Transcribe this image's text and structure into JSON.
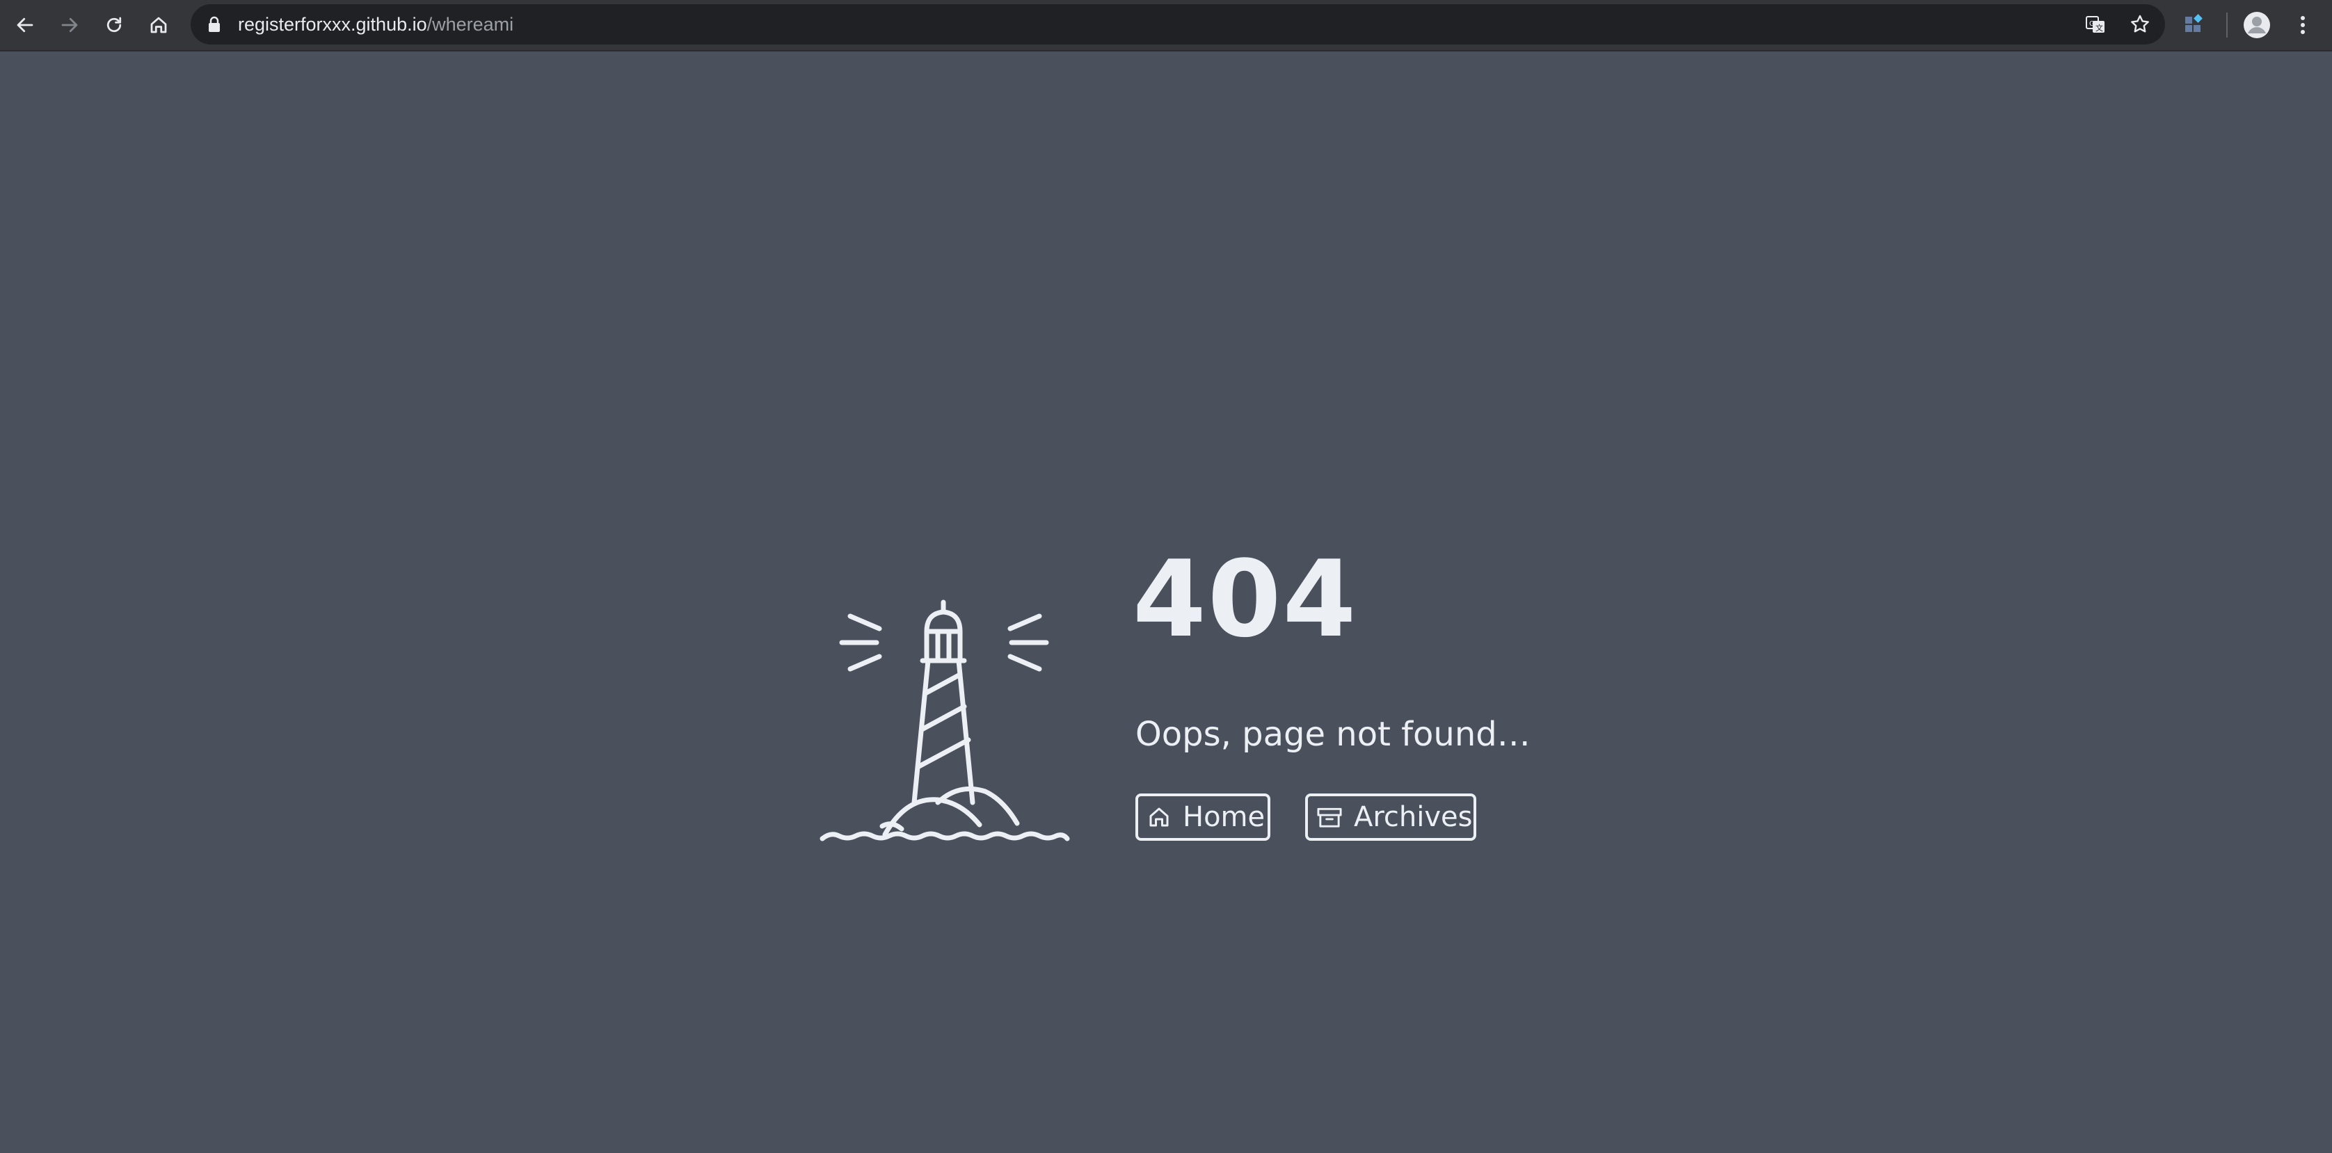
{
  "browser": {
    "url_host": "registerforxxx.github.io",
    "url_path": "/whereami",
    "icons": {
      "back": "arrow-left-icon",
      "forward": "arrow-right-icon",
      "reload": "reload-icon",
      "home": "home-icon",
      "lock": "lock-icon",
      "translate": "translate-icon",
      "bookmark": "star-icon",
      "extension": "extensions-icon",
      "profile": "avatar-icon",
      "menu": "kebab-menu-icon"
    },
    "colors": {
      "toolbar": "#35363a",
      "omnibox": "#202124",
      "accent": "#4fc3f7"
    }
  },
  "page": {
    "code": "404",
    "message": "Oops, page not found…",
    "illustration": "lighthouse-icon",
    "background": "#4a505c",
    "foreground": "#eceff4",
    "buttons": {
      "home_label": "Home",
      "archives_label": "Archives",
      "home_icon": "home-icon",
      "archives_icon": "archive-box-icon"
    }
  }
}
